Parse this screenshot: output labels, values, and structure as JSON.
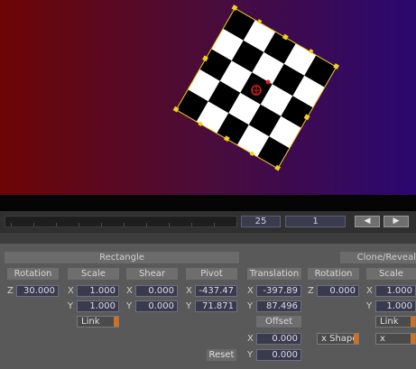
{
  "timeline": {
    "frame_value": "25",
    "step_value": "1",
    "prev_glyph": "◀",
    "next_glyph": "▶"
  },
  "panel": {
    "rectangle_header": "Rectangle",
    "clone_header": "Clone/Reveal",
    "rotation_label": "Rotation",
    "scale_label": "Scale",
    "shear_label": "Shear",
    "pivot_label": "Pivot",
    "translation_label": "Translation",
    "clone_rotation_label": "Rotation",
    "clone_scale_label": "Scale",
    "offset_label": "Offset",
    "z": "Z",
    "x": "X",
    "y": "Y",
    "rotation_z": "30.000",
    "scale_x": "1.000",
    "scale_y": "1.000",
    "shear_x": "0.000",
    "shear_y": "0.000",
    "pivot_x": "-437.47",
    "pivot_y": "71.871",
    "translation_x": "-397.89",
    "translation_y": "87.496",
    "clone_rotation_z": "0.000",
    "clone_scale_x": "1.000",
    "clone_scale_y": "1.000",
    "offset_x": "0.000",
    "offset_y": "0.000",
    "link_label": "Link",
    "clone_link_label": "Link",
    "x_shape_label": "x Shape",
    "x_shape2_label": "x Shape",
    "reset_label": "Reset"
  },
  "colors": {
    "indicator": "#d07020",
    "selection_handles": "#f0d020",
    "pivot_marker": "#e02020"
  }
}
